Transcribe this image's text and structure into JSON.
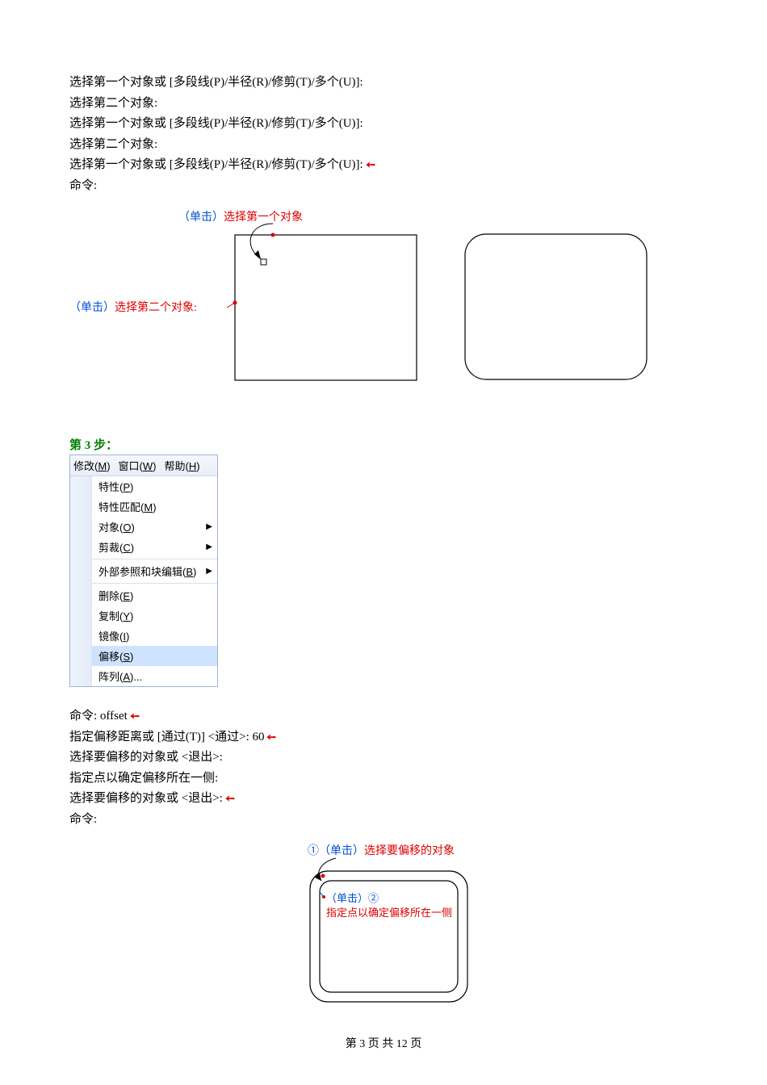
{
  "cmd_block_1": [
    {
      "text": "选择第一个对象或 [多段线(P)/半径(R)/修剪(T)/多个(U)]:",
      "enter": false
    },
    {
      "text": "选择第二个对象:",
      "enter": false
    },
    {
      "text": "选择第一个对象或 [多段线(P)/半径(R)/修剪(T)/多个(U)]:",
      "enter": false
    },
    {
      "text": "选择第二个对象:",
      "enter": false
    },
    {
      "text": "选择第一个对象或 [多段线(P)/半径(R)/修剪(T)/多个(U)]:",
      "enter": true
    },
    {
      "text": "命令:",
      "enter": false
    }
  ],
  "fig1": {
    "click1_prefix": "（单击）",
    "click1_label": "选择第一个对象",
    "click2_prefix": "（单击）",
    "click2_label": "选择第二个对象:"
  },
  "step_heading": "第 3 步：",
  "menu": {
    "bar": [
      "修改(M)",
      "窗口(W)",
      "帮助(H)"
    ],
    "items": [
      {
        "label": "特性(P)",
        "arrow": false,
        "sep_after": false
      },
      {
        "label": "特性匹配(M)",
        "arrow": false,
        "sep_after": false
      },
      {
        "label": "对象(O)",
        "arrow": true,
        "sep_after": false
      },
      {
        "label": "剪裁(C)",
        "arrow": true,
        "sep_after": true
      },
      {
        "label": "外部参照和块编辑(B)",
        "arrow": true,
        "sep_after": true
      },
      {
        "label": "删除(E)",
        "arrow": false,
        "sep_after": false
      },
      {
        "label": "复制(Y)",
        "arrow": false,
        "sep_after": false
      },
      {
        "label": "镜像(I)",
        "arrow": false,
        "sep_after": false
      },
      {
        "label": "偏移(S)",
        "arrow": false,
        "sep_after": false,
        "hl": true
      },
      {
        "label": "阵列(A)...",
        "arrow": false,
        "sep_after": false
      }
    ]
  },
  "cmd_block_2": [
    {
      "text": "命令: offset",
      "enter": true
    },
    {
      "text": "指定偏移距离或 [通过(T)] <通过>: 60",
      "enter": true
    },
    {
      "text": "选择要偏移的对象或 <退出>:",
      "enter": false
    },
    {
      "text": "指定点以确定偏移所在一侧:",
      "enter": false
    },
    {
      "text": "选择要偏移的对象或 <退出>:",
      "enter": true
    },
    {
      "text": "命令:",
      "enter": false
    }
  ],
  "fig2": {
    "top_prefix": "①（单击）",
    "top_label": "选择要偏移的对象",
    "inside_prefix": "（单击）",
    "inside_num": "②",
    "inside_label": "指定点以确定偏移所在一侧"
  },
  "footer": {
    "page_no": "3",
    "page_total": "12",
    "tpl": "第 {n} 页 共 {t} 页"
  }
}
